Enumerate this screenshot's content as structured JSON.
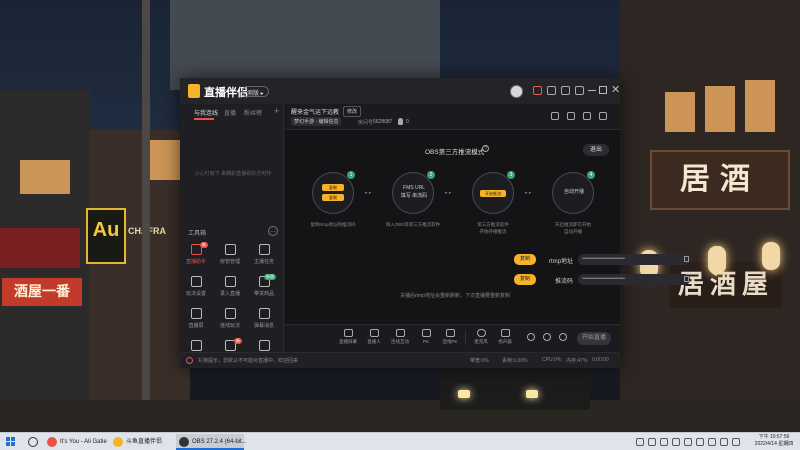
{
  "app": {
    "name": "直播伴侣",
    "version": "测版 ▸",
    "left_tabs": [
      "与我连线",
      "直播",
      "粉丝榜"
    ],
    "empty_message": "小心叮就下 来精彩直播看好方可作",
    "toolbox_title": "工具箱",
    "tools": [
      {
        "label": "直播助手",
        "badge": "新",
        "highlight": true
      },
      {
        "label": "房管管理",
        "badge": "",
        "highlight": false
      },
      {
        "label": "主播任务",
        "badge": "",
        "highlight": false
      },
      {
        "label": "玩法设置",
        "badge": "",
        "highlight": false
      },
      {
        "label": "录入直播",
        "badge": "",
        "highlight": false
      },
      {
        "label": "带货商品",
        "badge": "新版",
        "highlight": false
      },
      {
        "label": "直播屏",
        "badge": "",
        "highlight": false
      },
      {
        "label": "连线玩法",
        "badge": "",
        "highlight": false
      },
      {
        "label": "弹幕消息",
        "badge": "",
        "highlight": false
      },
      {
        "label": "直播提醒",
        "badge": "",
        "highlight": false
      },
      {
        "label": "小游戏",
        "badge": "新",
        "highlight": false
      },
      {
        "label": "粉丝管理",
        "badge": "",
        "highlight": false
      }
    ],
    "room": {
      "title": "醒来金气运下远教",
      "tag": "修改",
      "category": "梦幻手游 · 编辑信息",
      "id_label": "房间号",
      "id": "5628087",
      "fire_count": "0"
    },
    "obs": {
      "title": "OBS第三方推流模式",
      "exit_label": "退出",
      "steps": [
        {
          "num": "1",
          "pills": [
            "复制",
            "复制"
          ],
          "text": "",
          "desc": "复制rtmp地址和推流码"
        },
        {
          "num": "2",
          "pills": [],
          "text": "FMS URL\n填写 串流码",
          "desc": "填入OBS等第三方推流软件"
        },
        {
          "num": "3",
          "pills": [
            "开始推流"
          ],
          "text": "",
          "desc": "第三方推流软件\n开始开播推流"
        },
        {
          "num": "4",
          "pills": [],
          "text": "自动开播",
          "desc": "开启推流即可开始\n自动开播"
        }
      ],
      "rtmp_label": "rtmp地址",
      "rtmp_value": "••••••••••••••••••••••••••••••••••",
      "key_label": "推流码",
      "key_value": "••••••••••••••••••••••••••••••••••",
      "copy_label": "复制",
      "hint": "关播后rtmp地址会重新刷新，下次直播要重新复制"
    },
    "bottom": [
      {
        "label": "直播屏幕"
      },
      {
        "label": "直播人"
      },
      {
        "label": "连线互动"
      },
      {
        "label": "PK"
      },
      {
        "label": "连线PK"
      },
      {
        "label": "麦克风"
      },
      {
        "label": "扬声器"
      }
    ],
    "go_live": "开始直播",
    "status": {
      "message": "礼物提示，您默认不可能对直播中，欢迎回来",
      "items": [
        "带宽:0%",
        "丢帧:0.00%",
        "CPU:0%",
        "内存:47%",
        "0:00:00"
      ]
    }
  },
  "taskbar": {
    "tasks": [
      {
        "label": "It's You - Ali Gatie",
        "color": "#e8524a",
        "active": false
      },
      {
        "label": "斗鱼直播伴侣",
        "color": "#f6b327",
        "active": false
      },
      {
        "label": "OBS 27.2.4 (64-bit...",
        "color": "#333333",
        "active": true
      }
    ],
    "time": "下午 10:57:56",
    "date": "2022/4/14 星期四"
  },
  "wallpaper": {
    "sign_shop": "酒屋一番",
    "sign_au": "Au",
    "sign_chafra": "CHAFRA",
    "sign_big": "居酒",
    "sign_big2": "居酒屋"
  }
}
